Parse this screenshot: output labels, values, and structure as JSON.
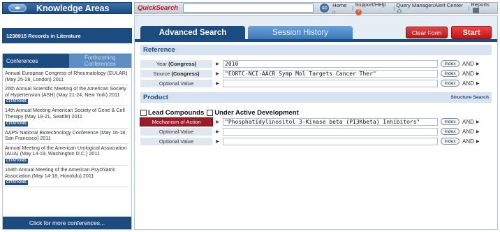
{
  "sidebar": {
    "title": "Knowledge Areas",
    "records_text": "1238915 Records in Literature",
    "tabs": {
      "active": "Conferences",
      "inactive": "Forthcoming Conferences"
    },
    "conferences": [
      {
        "text": "Annual European Congress of Rheumatology (EULAR) (May 25-28, London) 2011",
        "citations": false
      },
      {
        "text": "26th Annual Scientific Meeting of the American Society of Hypertension (ASH) (May 21-24, New York) 2011",
        "citations": true
      },
      {
        "text": "14th Annual Meeting American Society of Gene & Cell Therapy (May 18-21, Seattle) 2011",
        "citations": true
      },
      {
        "text": "AAPS National Biotechnology Conference (May 16-18, San Francisco) 2011",
        "citations": false
      },
      {
        "text": "Annual Meeting of the American Urological Association (AUA) (May 14-19, Washington D.C.) 2011",
        "citations": true
      },
      {
        "text": "164th Annual Meeting of the American Psychiatric Association (May 14-18, Honolulu) 2011",
        "citations": true
      }
    ],
    "citations_label": "CITATIONS",
    "more_label": "Click for more conferences..."
  },
  "topbar": {
    "quick_search_label": "QuickSearch",
    "quick_search_value": "",
    "go_label": "GO",
    "links": {
      "home": "Home",
      "support": "Support/Help",
      "query_manager": "Query Manager/Alert Center",
      "reports": "Reports"
    }
  },
  "main": {
    "tabs": {
      "advanced": "Advanced Search",
      "history": "Session History"
    },
    "clear_label": "Clear Form",
    "start_label": "Start",
    "reference": {
      "heading": "Reference",
      "rows": [
        {
          "label": "Year",
          "qualifier": "(Congress)",
          "value": "2010"
        },
        {
          "label": "Source",
          "qualifier": "(Congress)",
          "value": "\"EORTC-NCI-AACR Symp Mol Targets Cancer Ther\""
        },
        {
          "label": "Optional Value",
          "qualifier": "",
          "value": ""
        }
      ]
    },
    "product": {
      "heading": "Product",
      "structure_link": "Structure Search",
      "check_lead": "Lead Compounds",
      "check_dev": "Under Active Development",
      "rows": [
        {
          "label": "Mechanism of Action",
          "value": "\"Phosphatidylinositol 3-Kinase beta (PI3Kbeta) Inhibitors\""
        },
        {
          "label": "Optional Value",
          "value": ""
        },
        {
          "label": "Optional Value",
          "value": ""
        }
      ]
    },
    "index_label": "Index",
    "and_label": "AND"
  }
}
